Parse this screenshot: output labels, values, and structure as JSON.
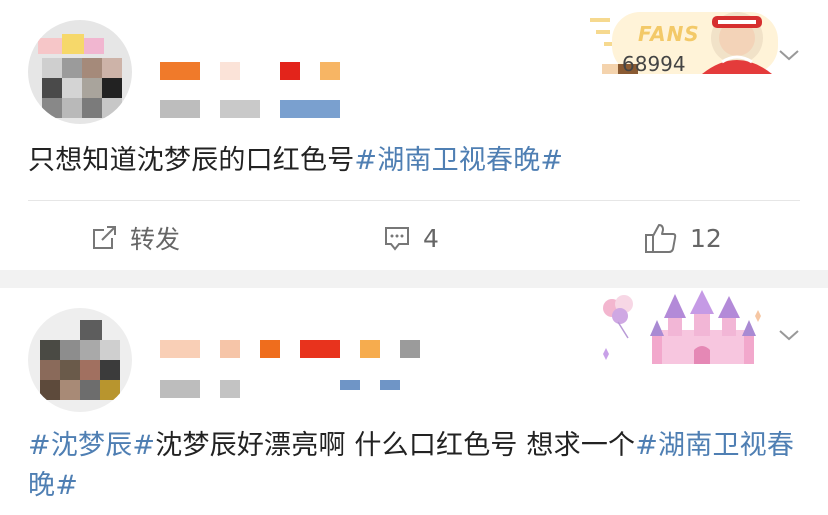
{
  "posts": [
    {
      "content_prefix": "只想知道沈梦辰的口红色号",
      "tag_suffix": "#湖南卫视春晚#",
      "badge": {
        "word": "FANS",
        "number": "68994"
      },
      "actions": {
        "repost": "转发",
        "comments": "4",
        "likes": "12"
      }
    },
    {
      "tag_prefix": "#沈梦辰#",
      "content": "沈梦辰好漂亮啊 什么口红色号 想求一个",
      "tag_suffix": "#湖南卫视春晚#"
    }
  ],
  "colors": {
    "tag": "#4f7fb3",
    "background": "#f2f2f2",
    "card": "#ffffff",
    "action_text": "#666666"
  },
  "icons": [
    "chevron-down-icon",
    "share-icon",
    "comment-icon",
    "thumbs-up-icon",
    "fans-badge-icon",
    "castle-badge-icon"
  ]
}
